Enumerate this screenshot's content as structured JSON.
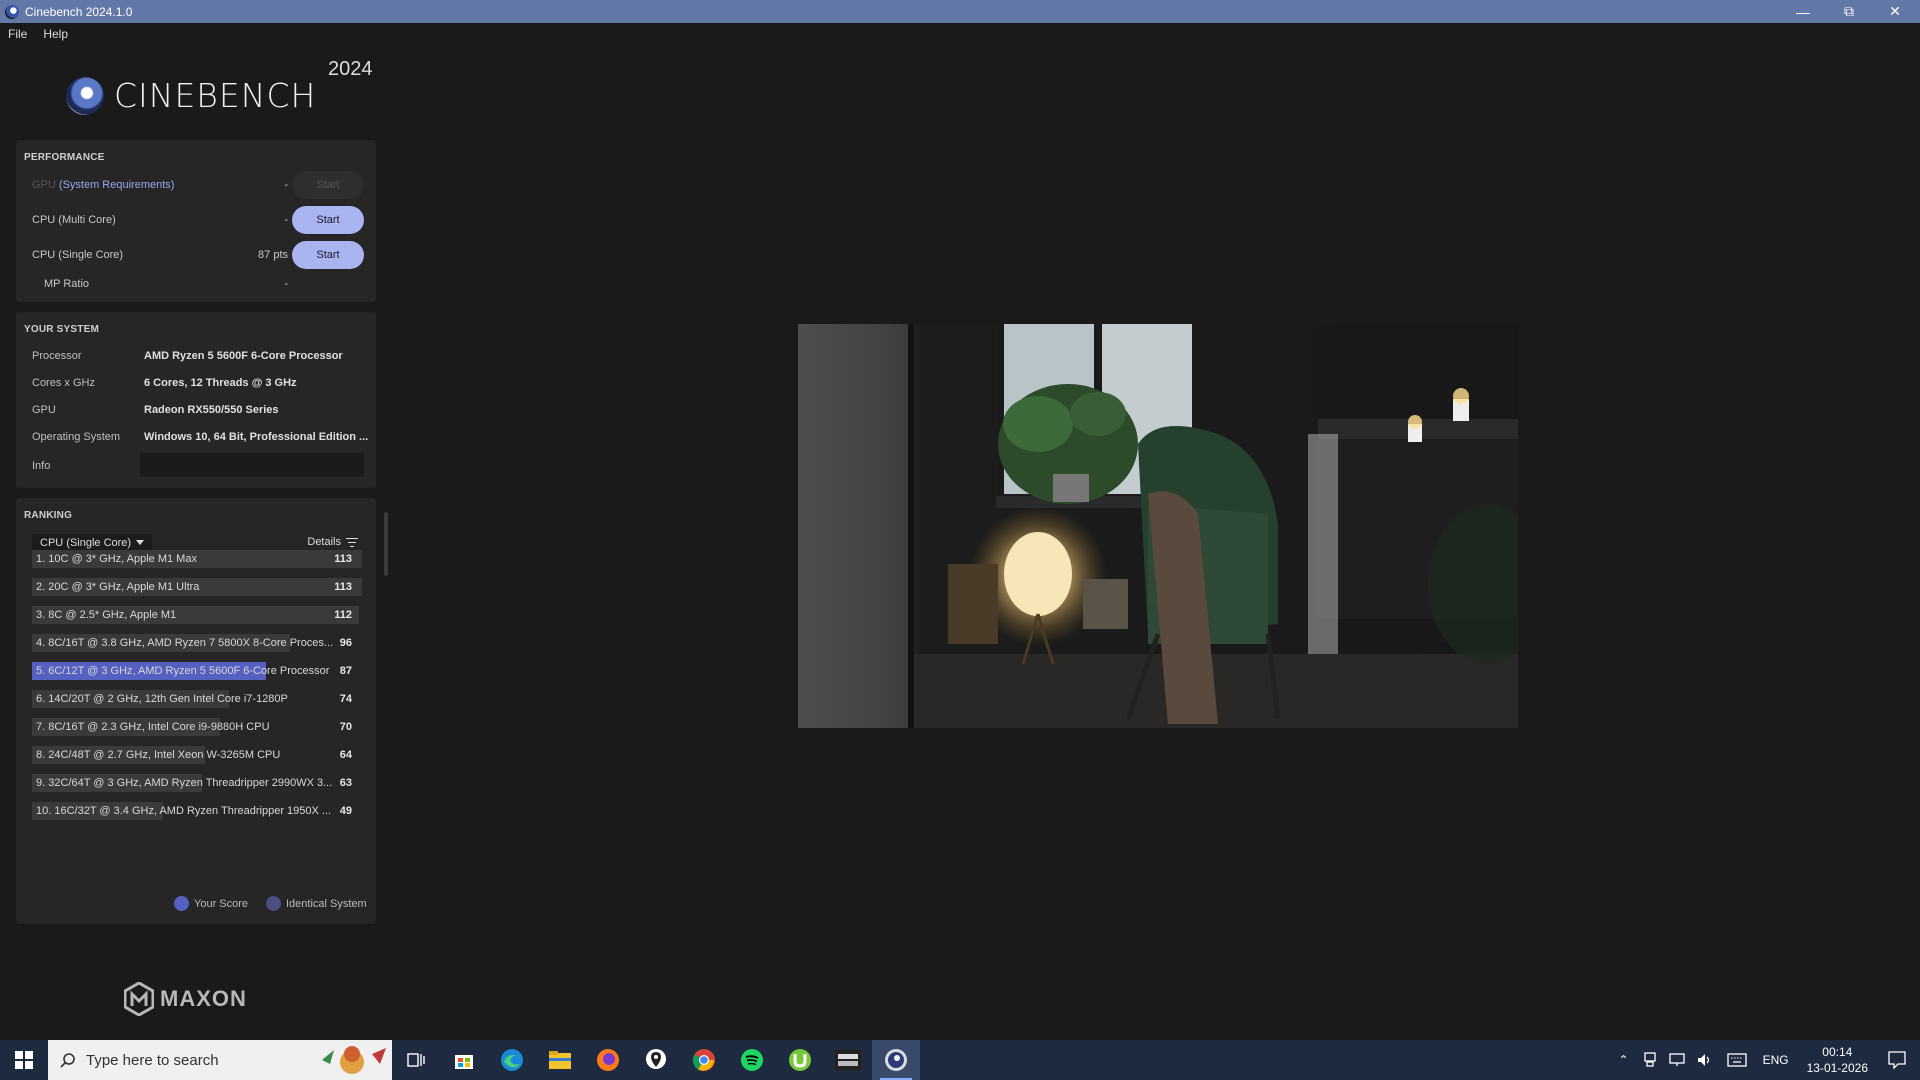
{
  "window": {
    "title": "Cinebench 2024.1.0"
  },
  "menu": [
    "File",
    "Help"
  ],
  "brand": {
    "name": "CINEBENCH",
    "year": "2024",
    "vendor": "MAXON"
  },
  "performance": {
    "title": "PERFORMANCE",
    "rows": [
      {
        "label_dim": "GPU",
        "label_link": "(System Requirements)",
        "value": "-",
        "button": "Start",
        "enabled": false
      },
      {
        "label": "CPU (Multi Core)",
        "value": "-",
        "button": "Start",
        "enabled": true
      },
      {
        "label": "CPU (Single Core)",
        "value": "87 pts",
        "button": "Start",
        "enabled": true
      },
      {
        "label": "MP Ratio",
        "value": "-"
      }
    ]
  },
  "system": {
    "title": "YOUR SYSTEM",
    "rows": [
      {
        "key": "Processor",
        "value": "AMD Ryzen 5 5600F 6-Core Processor"
      },
      {
        "key": "Cores x GHz",
        "value": "6 Cores, 12 Threads @ 3 GHz"
      },
      {
        "key": "GPU",
        "value": "Radeon RX550/550 Series"
      },
      {
        "key": "Operating System",
        "value": "Windows 10, 64 Bit, Professional Edition ..."
      },
      {
        "key": "Info",
        "value": ""
      }
    ]
  },
  "ranking": {
    "title": "RANKING",
    "selected": "CPU (Single Core)",
    "details_label": "Details",
    "entries": [
      {
        "name": "1. 10C @ 3* GHz, Apple M1 Max",
        "score": "113",
        "fraction": 1.0,
        "you": false
      },
      {
        "name": "2. 20C @ 3* GHz, Apple M1 Ultra",
        "score": "113",
        "fraction": 1.0,
        "you": false
      },
      {
        "name": "3. 8C @ 2.5* GHz, Apple M1",
        "score": "112",
        "fraction": 0.99,
        "you": false
      },
      {
        "name": "4. 8C/16T @ 3.8 GHz, AMD Ryzen 7 5800X 8-Core Proces...",
        "score": "96",
        "fraction": 0.85,
        "you": false
      },
      {
        "name": "5. 6C/12T @ 3 GHz, AMD Ryzen 5 5600F 6-Core Processor",
        "score": "87",
        "fraction": 0.77,
        "you": true
      },
      {
        "name": "6. 14C/20T @ 2 GHz, 12th Gen Intel Core i7-1280P",
        "score": "74",
        "fraction": 0.65,
        "you": false
      },
      {
        "name": "7. 8C/16T @ 2.3 GHz, Intel Core i9-9880H CPU",
        "score": "70",
        "fraction": 0.62,
        "you": false
      },
      {
        "name": "8. 24C/48T @ 2.7 GHz, Intel Xeon W-3265M CPU",
        "score": "64",
        "fraction": 0.57,
        "you": false
      },
      {
        "name": "9. 32C/64T @ 3 GHz, AMD Ryzen Threadripper 2990WX 3...",
        "score": "63",
        "fraction": 0.56,
        "you": false
      },
      {
        "name": "10. 16C/32T @ 3.4 GHz, AMD Ryzen Threadripper 1950X ...",
        "score": "49",
        "fraction": 0.43,
        "you": false
      }
    ],
    "legend": [
      {
        "label": "Your Score",
        "color": "#5560c0"
      },
      {
        "label": "Identical System",
        "color": "#4a4e80"
      }
    ]
  },
  "colors": {
    "titlebar": "#6478a8",
    "button": "#a9b4f0",
    "your_score": "#5560c0"
  },
  "taskbar": {
    "search_placeholder": "Type here to search",
    "apps": [
      "task-view-icon",
      "store-icon",
      "edge-icon",
      "file-explorer-icon",
      "firefox-icon",
      "maps-pin-icon",
      "chrome-icon",
      "spotify-icon",
      "utorrent-icon",
      "sniper-elite-icon",
      "cinebench-icon"
    ],
    "lang": "ENG",
    "time": "00:14",
    "date": "13-01-2026"
  }
}
